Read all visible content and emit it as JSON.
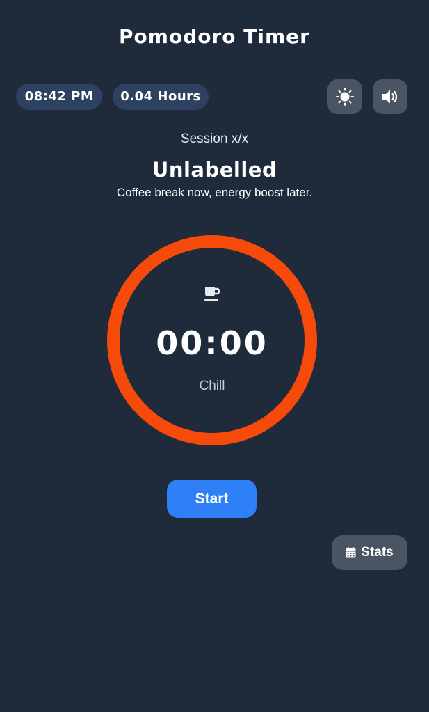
{
  "header": {
    "title": "Pomodoro Timer"
  },
  "status": {
    "clock": "08:42 PM",
    "hours": "0.04 Hours"
  },
  "controls": {
    "theme_icon": "sun-icon",
    "sound_icon": "volume-icon"
  },
  "session": {
    "label": "Session x/x",
    "title": "Unlabelled",
    "subtitle": "Coffee break now, energy boost later."
  },
  "timer": {
    "icon": "coffee-cup-icon",
    "time": "00:00",
    "mode": "Chill",
    "ring_color": "#f54a0a"
  },
  "actions": {
    "start_label": "Start",
    "stats_label": "Stats",
    "stats_icon": "calendar-icon"
  },
  "colors": {
    "background": "#1f2a3a",
    "pill": "#2d4260",
    "icon_button": "#4a5462",
    "primary": "#2f80f6",
    "accent": "#f54a0a"
  }
}
